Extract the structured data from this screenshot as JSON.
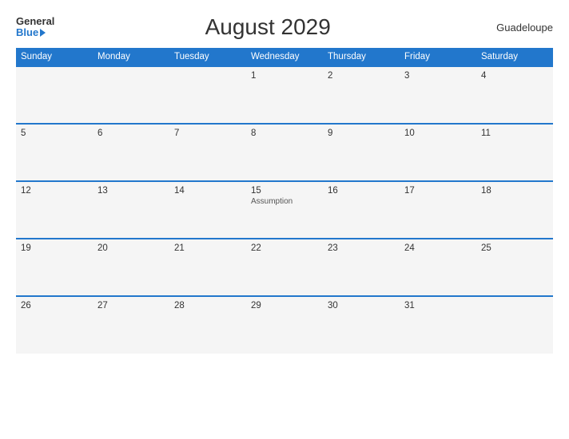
{
  "header": {
    "logo_general": "General",
    "logo_blue": "Blue",
    "title": "August 2029",
    "region": "Guadeloupe"
  },
  "days_of_week": [
    "Sunday",
    "Monday",
    "Tuesday",
    "Wednesday",
    "Thursday",
    "Friday",
    "Saturday"
  ],
  "weeks": [
    [
      {
        "num": "",
        "event": ""
      },
      {
        "num": "",
        "event": ""
      },
      {
        "num": "",
        "event": ""
      },
      {
        "num": "1",
        "event": ""
      },
      {
        "num": "2",
        "event": ""
      },
      {
        "num": "3",
        "event": ""
      },
      {
        "num": "4",
        "event": ""
      }
    ],
    [
      {
        "num": "5",
        "event": ""
      },
      {
        "num": "6",
        "event": ""
      },
      {
        "num": "7",
        "event": ""
      },
      {
        "num": "8",
        "event": ""
      },
      {
        "num": "9",
        "event": ""
      },
      {
        "num": "10",
        "event": ""
      },
      {
        "num": "11",
        "event": ""
      }
    ],
    [
      {
        "num": "12",
        "event": ""
      },
      {
        "num": "13",
        "event": ""
      },
      {
        "num": "14",
        "event": ""
      },
      {
        "num": "15",
        "event": "Assumption"
      },
      {
        "num": "16",
        "event": ""
      },
      {
        "num": "17",
        "event": ""
      },
      {
        "num": "18",
        "event": ""
      }
    ],
    [
      {
        "num": "19",
        "event": ""
      },
      {
        "num": "20",
        "event": ""
      },
      {
        "num": "21",
        "event": ""
      },
      {
        "num": "22",
        "event": ""
      },
      {
        "num": "23",
        "event": ""
      },
      {
        "num": "24",
        "event": ""
      },
      {
        "num": "25",
        "event": ""
      }
    ],
    [
      {
        "num": "26",
        "event": ""
      },
      {
        "num": "27",
        "event": ""
      },
      {
        "num": "28",
        "event": ""
      },
      {
        "num": "29",
        "event": ""
      },
      {
        "num": "30",
        "event": ""
      },
      {
        "num": "31",
        "event": ""
      },
      {
        "num": "",
        "event": ""
      }
    ]
  ]
}
